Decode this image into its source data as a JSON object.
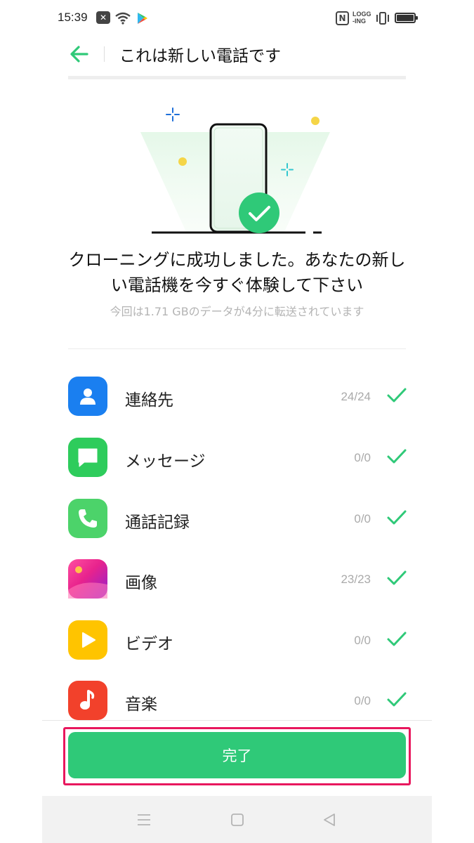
{
  "status_bar": {
    "time": "15:39",
    "notification_icon": "close-box-icon",
    "nfc_label": "N",
    "logging_label_line1": "LOGG",
    "logging_label_line2": "-ING"
  },
  "header": {
    "back_icon": "arrow-left-icon",
    "title": "これは新しい電話です"
  },
  "message": {
    "title": "クローニングに成功しました。あなたの新しい電話機を今すぐ体験して下さい",
    "subtitle": "今回は1.71 GBのデータが4分に転送されています"
  },
  "items": [
    {
      "label": "連絡先",
      "count": "24/24",
      "icon": "contacts-icon"
    },
    {
      "label": "メッセージ",
      "count": "0/0",
      "icon": "messages-icon"
    },
    {
      "label": "通話記録",
      "count": "0/0",
      "icon": "call-log-icon"
    },
    {
      "label": "画像",
      "count": "23/23",
      "icon": "images-icon"
    },
    {
      "label": "ビデオ",
      "count": "0/0",
      "icon": "video-icon"
    },
    {
      "label": "音楽",
      "count": "0/0",
      "icon": "music-icon"
    }
  ],
  "done_button": {
    "label": "完了"
  },
  "colors": {
    "accent": "#2fc978",
    "highlight_border": "#e8175d",
    "contacts": "#1a7ff0",
    "messages": "#2ecc5c",
    "call_log": "#4cd36a",
    "images": "#e8238d",
    "video": "#ffc400",
    "music": "#f2412b"
  }
}
